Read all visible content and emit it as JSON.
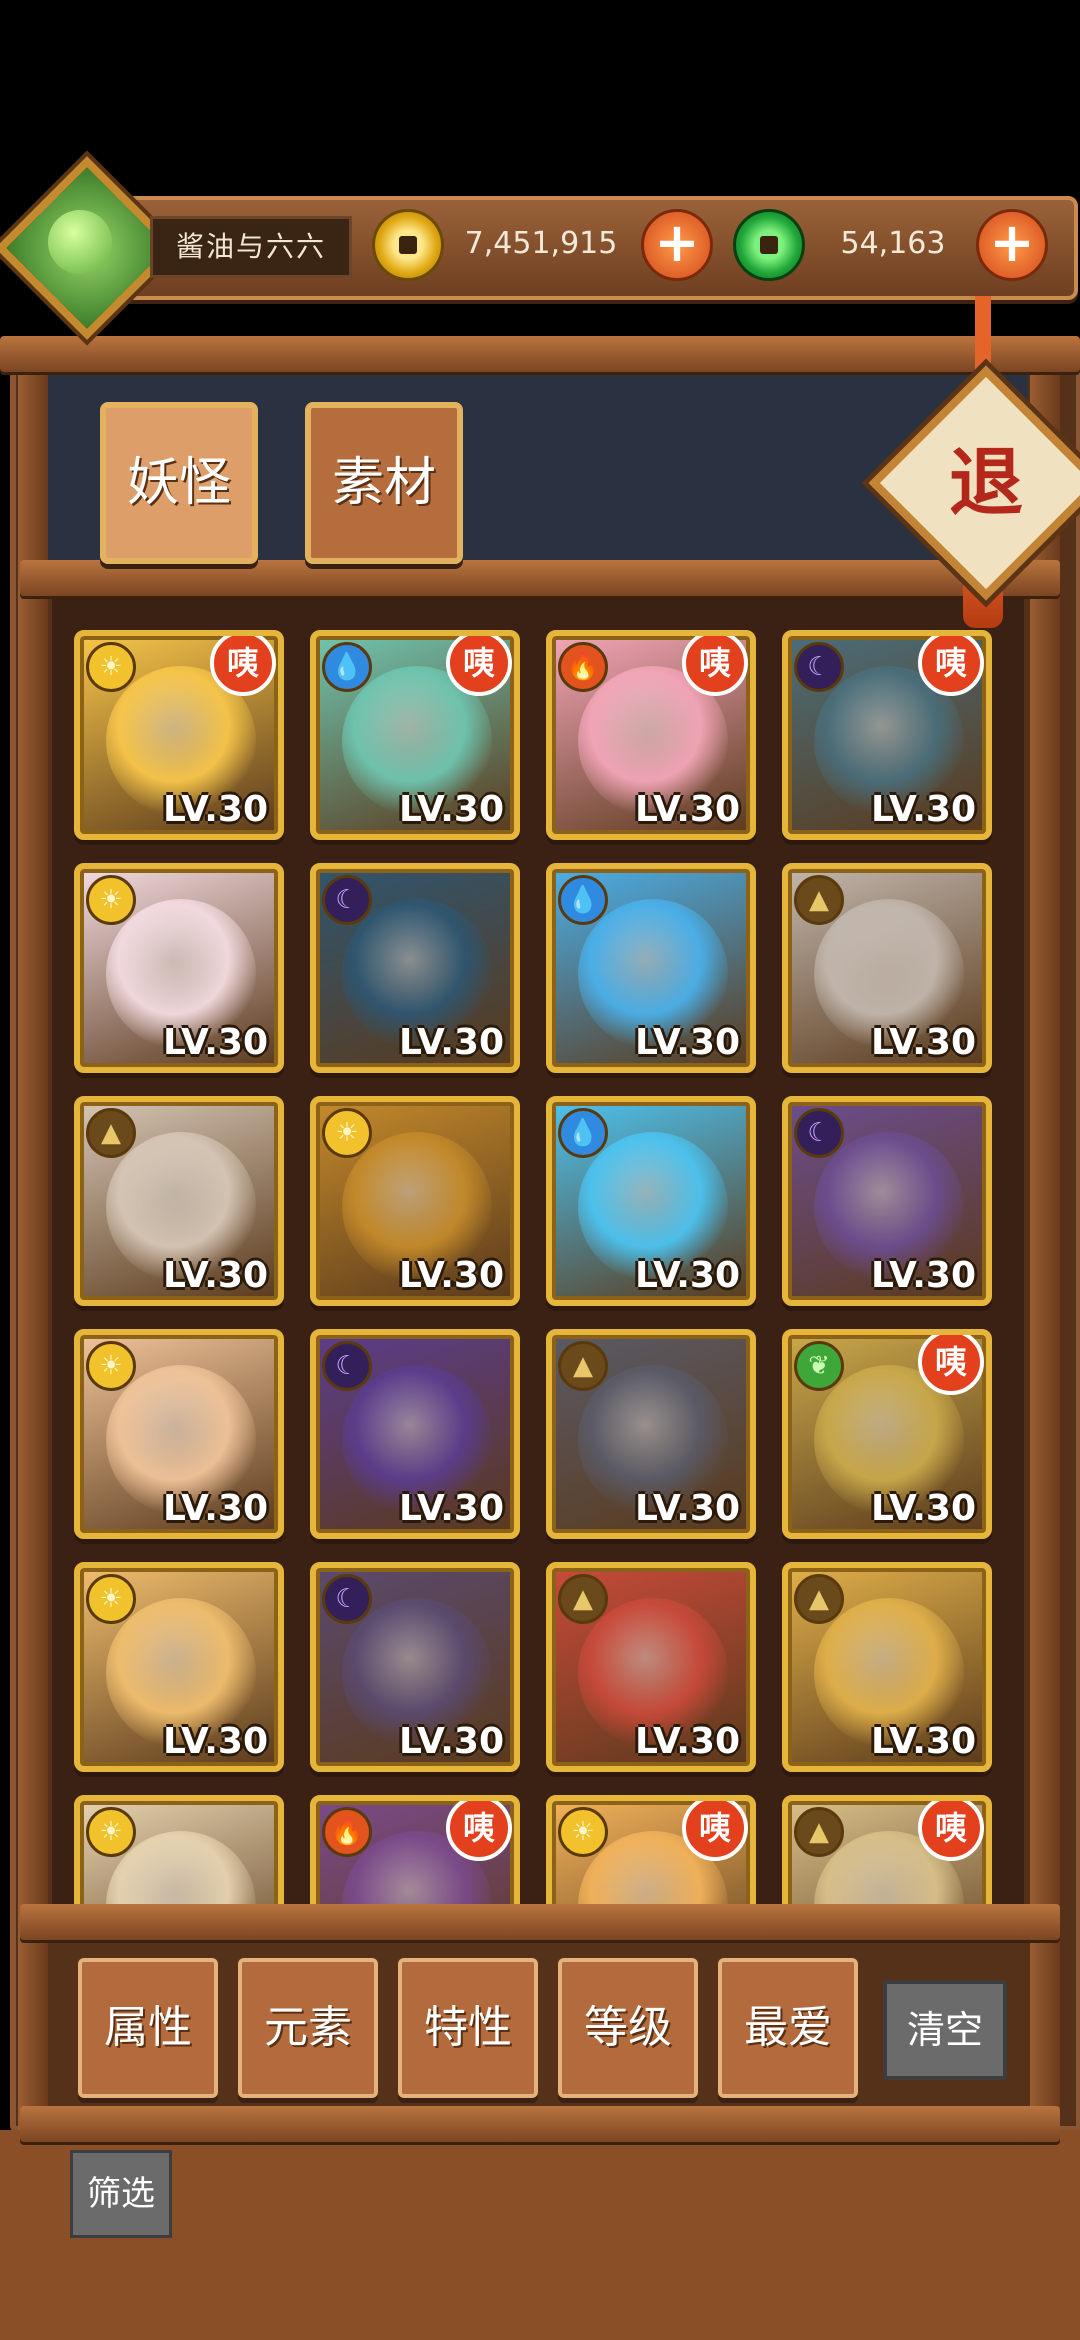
{
  "player": {
    "name": "酱油与六六",
    "gold": "7,451,915",
    "jade": "54,163"
  },
  "tabs": [
    "妖怪",
    "素材"
  ],
  "exit_label": "退",
  "badge_label": "咦",
  "level_label": "LV.30",
  "monsters": [
    {
      "element": "light",
      "badge": true,
      "color": "#f7c64a"
    },
    {
      "element": "water",
      "badge": true,
      "color": "#6fc5b0"
    },
    {
      "element": "fire",
      "badge": true,
      "color": "#f3a6b8"
    },
    {
      "element": "dark",
      "badge": true,
      "color": "#4a6e7a"
    },
    {
      "element": "light",
      "badge": false,
      "color": "#f3dbe0"
    },
    {
      "element": "dark",
      "badge": false,
      "color": "#2f5670"
    },
    {
      "element": "water",
      "badge": false,
      "color": "#4ab0ea"
    },
    {
      "element": "earth",
      "badge": false,
      "color": "#c2b7ad"
    },
    {
      "element": "earth",
      "badge": false,
      "color": "#d6c6b5"
    },
    {
      "element": "light",
      "badge": false,
      "color": "#c48a2b"
    },
    {
      "element": "water",
      "badge": false,
      "color": "#4cc3f0"
    },
    {
      "element": "dark",
      "badge": false,
      "color": "#6c4d8e"
    },
    {
      "element": "light",
      "badge": false,
      "color": "#f0c49a"
    },
    {
      "element": "dark",
      "badge": false,
      "color": "#5b3c8c"
    },
    {
      "element": "earth",
      "badge": false,
      "color": "#5a5a66"
    },
    {
      "element": "wood",
      "badge": true,
      "color": "#c9a94a"
    },
    {
      "element": "light",
      "badge": false,
      "color": "#f0be6e"
    },
    {
      "element": "dark",
      "badge": false,
      "color": "#5a4a6e"
    },
    {
      "element": "earth",
      "badge": false,
      "color": "#c84a3a"
    },
    {
      "element": "earth",
      "badge": false,
      "color": "#e0b04a"
    },
    {
      "element": "light",
      "badge": false,
      "color": "#e6d3b0"
    },
    {
      "element": "fire",
      "badge": true,
      "color": "#7a4a8a"
    },
    {
      "element": "light",
      "badge": true,
      "color": "#f2b25a"
    },
    {
      "element": "earth",
      "badge": true,
      "color": "#d8c08a"
    }
  ],
  "element_icons": {
    "light": "☀",
    "water": "💧",
    "fire": "🔥",
    "dark": "☾",
    "earth": "▲",
    "wood": "❦"
  },
  "filters": [
    "属性",
    "元素",
    "特性",
    "等级",
    "最爱"
  ],
  "clear_label": "清空",
  "screen_label": "筛选",
  "colors": {
    "frame": "#563119",
    "card_border": "#e5b63a",
    "badge": "#e3401d"
  }
}
